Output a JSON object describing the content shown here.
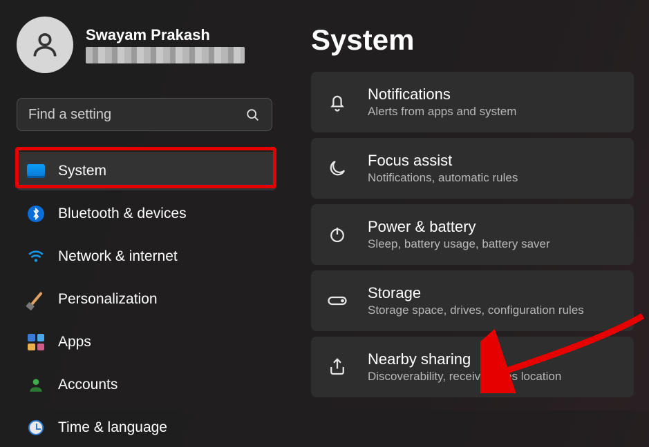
{
  "profile": {
    "name": "Swayam Prakash"
  },
  "search": {
    "placeholder": "Find a setting"
  },
  "sidebar": {
    "items": [
      {
        "label": "System",
        "icon": "system-icon",
        "active": true
      },
      {
        "label": "Bluetooth & devices",
        "icon": "bluetooth-icon"
      },
      {
        "label": "Network & internet",
        "icon": "wifi-icon"
      },
      {
        "label": "Personalization",
        "icon": "paintbrush-icon"
      },
      {
        "label": "Apps",
        "icon": "apps-icon"
      },
      {
        "label": "Accounts",
        "icon": "person-icon"
      },
      {
        "label": "Time & language",
        "icon": "clock-globe-icon"
      }
    ]
  },
  "main": {
    "title": "System",
    "cards": [
      {
        "icon": "bell-icon",
        "title": "Notifications",
        "sub": "Alerts from apps and system"
      },
      {
        "icon": "moon-icon",
        "title": "Focus assist",
        "sub": "Notifications, automatic rules"
      },
      {
        "icon": "power-icon",
        "title": "Power & battery",
        "sub": "Sleep, battery usage, battery saver"
      },
      {
        "icon": "drive-icon",
        "title": "Storage",
        "sub": "Storage space, drives, configuration rules"
      },
      {
        "icon": "share-icon",
        "title": "Nearby sharing",
        "sub": "Discoverability, received files location"
      }
    ]
  },
  "annotations": {
    "highlighted_sidebar_item": "System",
    "arrow_target_card": "Nearby sharing"
  }
}
